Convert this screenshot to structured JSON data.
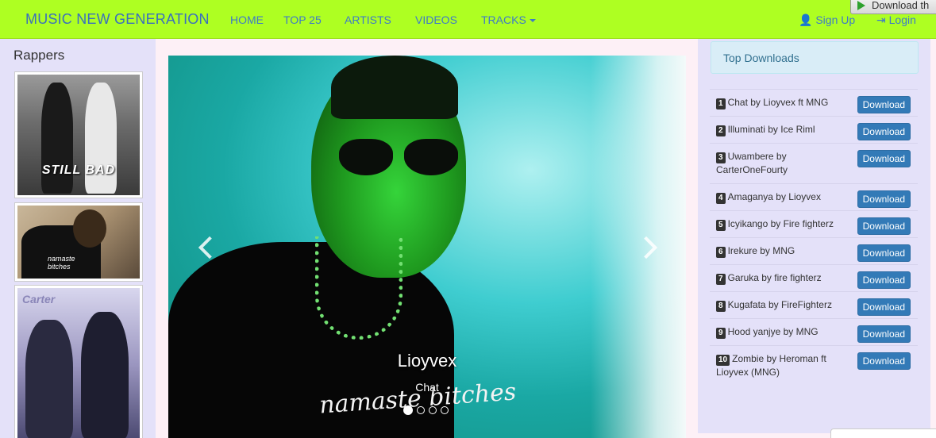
{
  "nav": {
    "brand": "MUSIC NEW GENERATION",
    "items": [
      "HOME",
      "TOP 25",
      "ARTISTS",
      "VIDEOS",
      "TRACKS"
    ],
    "signup": "Sign Up",
    "login": "Login",
    "download_bar": "Download th"
  },
  "sidebar": {
    "title": "Rappers",
    "thumb_texts": [
      "STILL BAD",
      "namaste bitches",
      "Carter"
    ]
  },
  "carousel": {
    "title": "Lioyvex",
    "subtitle": "Chat",
    "shirt_text": "namaste bitches",
    "slide_count": 4,
    "active_slide": 1
  },
  "downloads": {
    "heading": "Top Downloads",
    "button_label": "Download",
    "items": [
      {
        "rank": "1",
        "text": "Chat by Lioyvex ft MNG"
      },
      {
        "rank": "2",
        "text": "Illuminati by Ice Riml"
      },
      {
        "rank": "3",
        "text": "Uwambere by CarterOneFourty"
      },
      {
        "rank": "4",
        "text": "Amaganya by Lioyvex"
      },
      {
        "rank": "5",
        "text": "Icyikango by Fire fighterz"
      },
      {
        "rank": "6",
        "text": "Irekure by MNG"
      },
      {
        "rank": "7",
        "text": "Garuka by fire fighterz"
      },
      {
        "rank": "8",
        "text": "Kugafata by FireFighterz"
      },
      {
        "rank": "9",
        "text": "Hood yanjye by MNG"
      },
      {
        "rank": "10",
        "text": "Zombie by Heroman ft Lioyvex (MNG)"
      }
    ]
  },
  "colors": {
    "navbar": "#aeff22",
    "link": "#3f7ac8",
    "button": "#337ab7",
    "sidebar": "#e4e1f9"
  }
}
